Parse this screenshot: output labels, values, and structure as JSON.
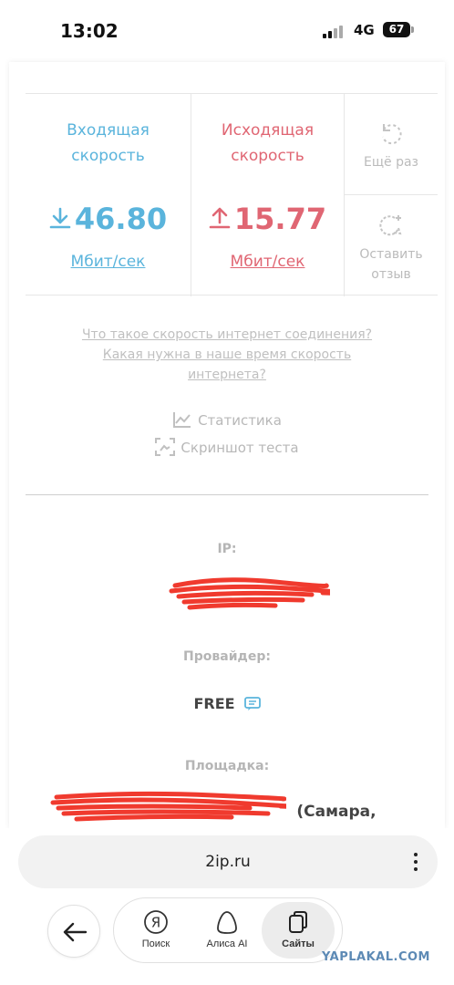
{
  "status_bar": {
    "time": "13:02",
    "network": "4G",
    "battery": "67"
  },
  "results": {
    "download": {
      "title_line1": "Входящая",
      "title_line2": "скорость",
      "value": "46.80",
      "unit": "Мбит/сек"
    },
    "upload": {
      "title_line1": "Исходящая",
      "title_line2": "скорость",
      "value": "15.77",
      "unit": "Мбит/сек"
    },
    "actions": {
      "retry": "Ещё раз",
      "review_line1": "Оставить",
      "review_line2": "отзыв"
    }
  },
  "links": {
    "line1": "Что такое скорость интернет соединения?",
    "line2": "Какая нужна в наше время скорость",
    "line3": "интернета?"
  },
  "tools": {
    "statistics": "Статистика",
    "screenshot": "Скриншот теста"
  },
  "info": {
    "ip_label": "IP:",
    "provider_label": "Провайдер:",
    "provider_value": "FREE",
    "site_label": "Площадка:",
    "site_value": "(Самара,"
  },
  "browser": {
    "url": "2ip.ru"
  },
  "nav": {
    "search": "Поиск",
    "alice": "Алиса AI",
    "sites": "Сайты"
  },
  "watermark": "YAPLAKAL.COM",
  "colors": {
    "download": "#5ab4dc",
    "upload": "#e06673",
    "redaction": "#f03a2e"
  }
}
